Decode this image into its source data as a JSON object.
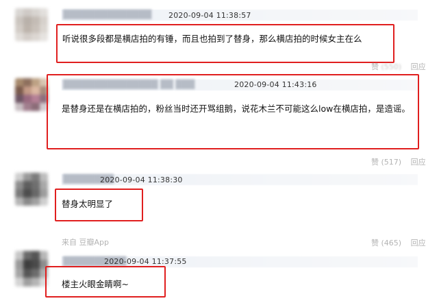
{
  "comments": [
    {
      "timestamp": "2020-09-04 11:38:57",
      "content": "听说很多段都是横店拍的有锤，而且也拍到了替身，那么横店拍的时候女主在么",
      "like_label": "赞",
      "like_count": "(550)",
      "reply_label": "回应"
    },
    {
      "timestamp": "2020-09-04 11:43:16",
      "content": "是替身还是在横店拍的，粉丝当时还开骂组鹅，说花木兰不可能这么low在横店拍，是造谣。",
      "like_label": "赞",
      "like_count": "(517)",
      "reply_label": "回应"
    },
    {
      "timestamp": "2020-09-04 11:38:30",
      "content": "替身太明显了",
      "source": "来自 豆瓣App",
      "like_label": "赞",
      "like_count": "(465)",
      "reply_label": "回应"
    },
    {
      "timestamp": "2020-09-04 11:37:55",
      "content": "楼主火眼金睛啊~"
    }
  ],
  "annotation_color": "#e01e1e"
}
